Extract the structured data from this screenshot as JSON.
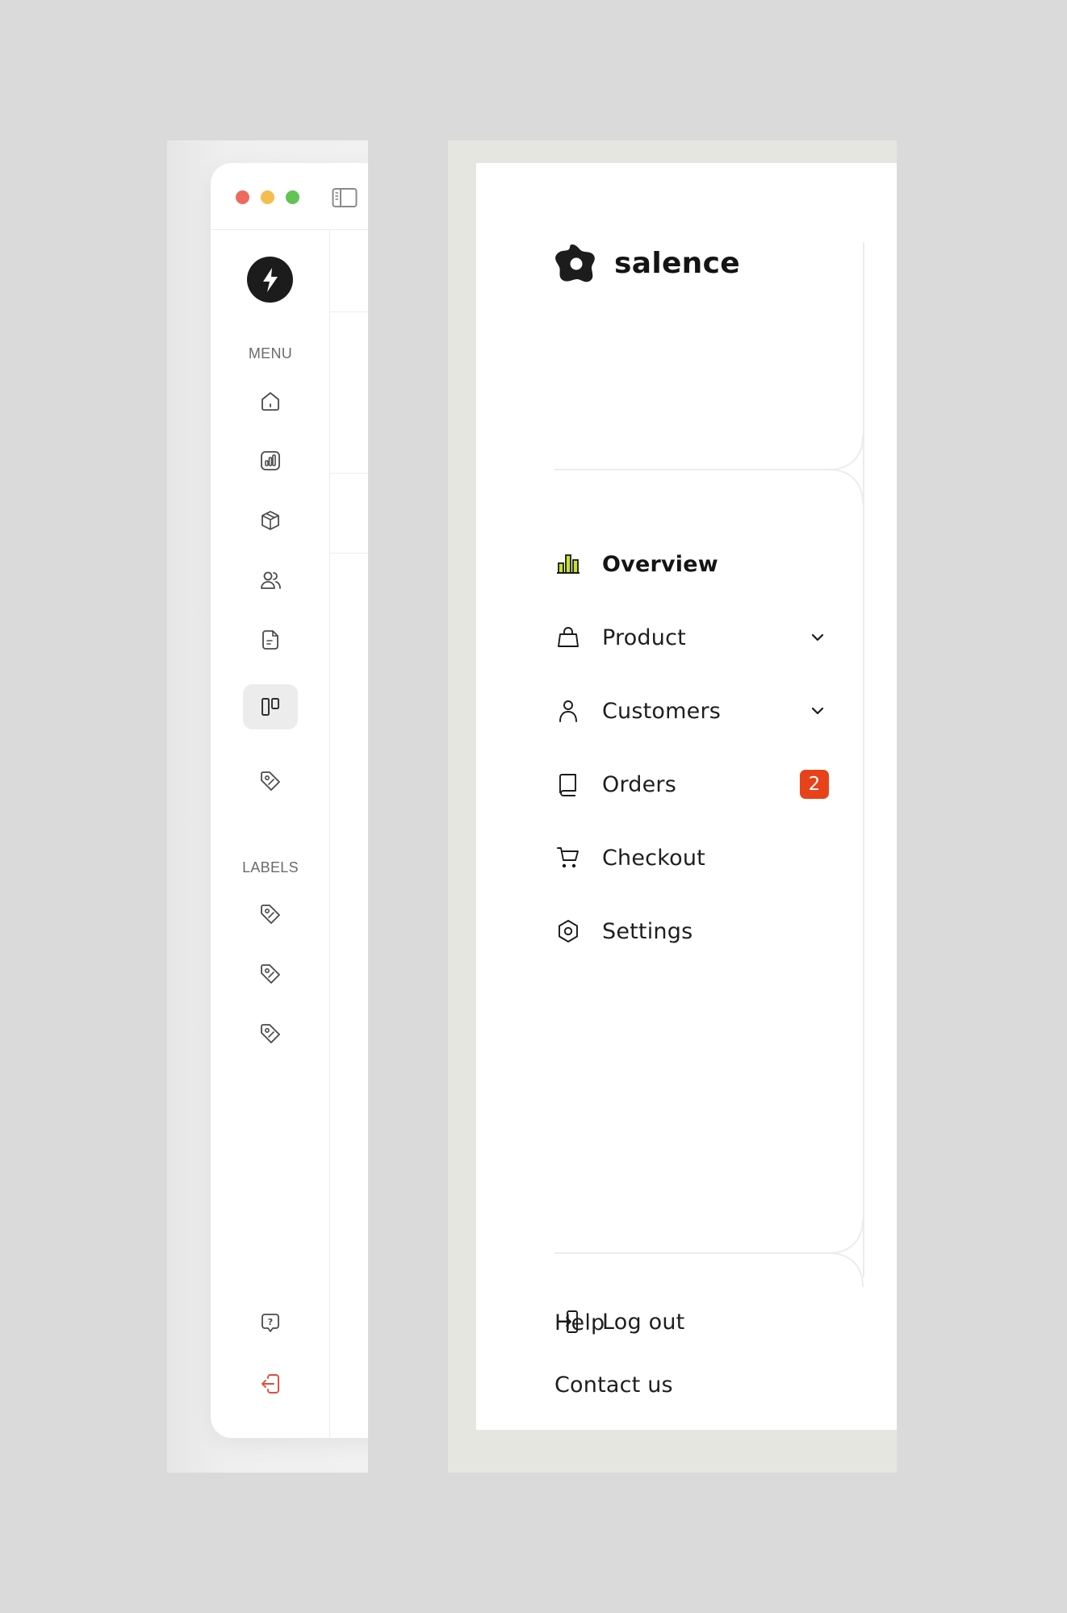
{
  "compact_sidebar": {
    "window_controls": [
      "close",
      "minimize",
      "maximize"
    ],
    "brand_icon": "lightning-bolt-icon",
    "menu_label": "MENU",
    "menu_icons": [
      "home-icon",
      "chart-icon",
      "box-icon",
      "users-icon",
      "document-icon",
      "kanban-icon",
      "tag-icon"
    ],
    "active_index": 5,
    "labels_label": "LABELS",
    "label_icons": [
      "tag-icon",
      "tag-icon",
      "tag-icon"
    ],
    "bottom_icons": [
      "help-bubble-icon",
      "logout-icon"
    ],
    "logout_color": "#e34a3a"
  },
  "expanded_sidebar": {
    "brand": {
      "name": "salence",
      "icon": "salence-logo-icon"
    },
    "nav": [
      {
        "label": "Overview",
        "icon": "bar-chart-icon",
        "active": true
      },
      {
        "label": "Product",
        "icon": "shopping-bag-icon",
        "expandable": true
      },
      {
        "label": "Customers",
        "icon": "person-icon",
        "expandable": true
      },
      {
        "label": "Orders",
        "icon": "book-icon",
        "badge": "2"
      },
      {
        "label": "Checkout",
        "icon": "cart-icon"
      },
      {
        "label": "Settings",
        "icon": "hexagon-settings-icon"
      }
    ],
    "footer": {
      "help": "Help",
      "contact": "Contact us",
      "logout": "Log out"
    },
    "accent_color": "#c6e32a",
    "badge_color": "#e8421b"
  }
}
